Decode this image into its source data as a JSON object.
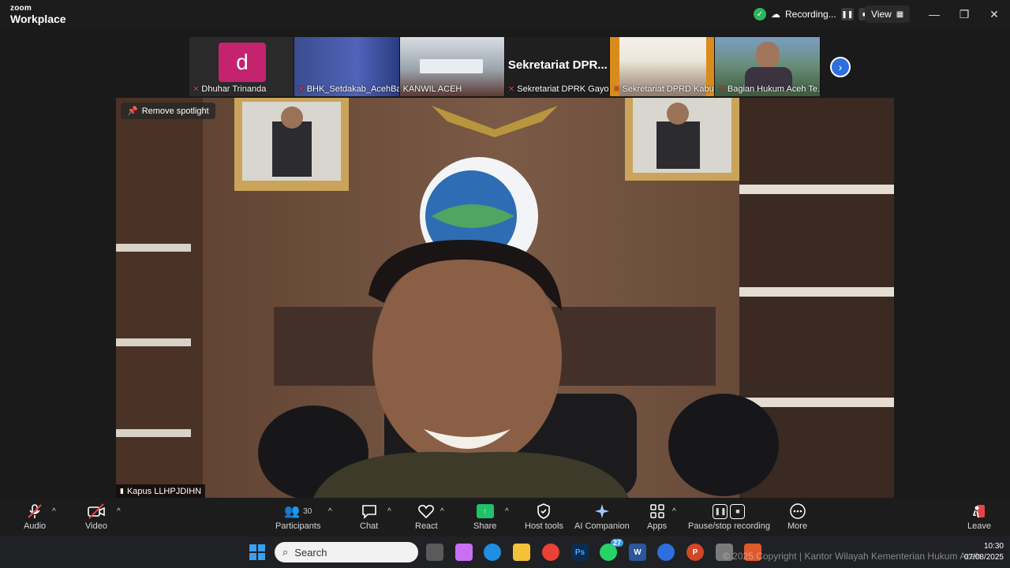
{
  "app": {
    "brand_small": "zoom",
    "brand_big": "Workplace"
  },
  "recording": {
    "status": "Recording..."
  },
  "view_label": "View",
  "participants_strip": [
    {
      "name": "Dhuhar Trinanda",
      "avatar_letter": "d"
    },
    {
      "name": "BHK_Setdakab_AcehBa..."
    },
    {
      "name": "KANWIL ACEH"
    },
    {
      "name": "Sekretariat DPRK Gayo...",
      "tile_text": "Sekretariat  DPR..."
    },
    {
      "name": "Sekretariat DPRD Kabu..."
    },
    {
      "name": "Bagian Hukum Aceh Te..."
    }
  ],
  "main": {
    "spotlight_button": "Remove spotlight",
    "speaker_name": "Kapus LLHPJDIHN"
  },
  "toolbar": {
    "audio": "Audio",
    "video": "Video",
    "participants": "Participants",
    "participants_count": "30",
    "chat": "Chat",
    "react": "React",
    "share": "Share",
    "host_tools": "Host tools",
    "ai_companion": "AI Companion",
    "apps": "Apps",
    "pause_stop": "Pause/stop recording",
    "more": "More",
    "leave": "Leave"
  },
  "taskbar": {
    "search_placeholder": "Search",
    "time": "10:30",
    "date": "07/08/2025",
    "whatsapp_badge": "27",
    "copyright": "© 2025 Copyright | Kantor Wilayah Kementerian Hukum Aceh"
  },
  "colors": {
    "accent": "#2d6fde",
    "share_green": "#1dc26a",
    "avatar_pink": "#c3236f",
    "rec_green": "#2fb55c"
  }
}
